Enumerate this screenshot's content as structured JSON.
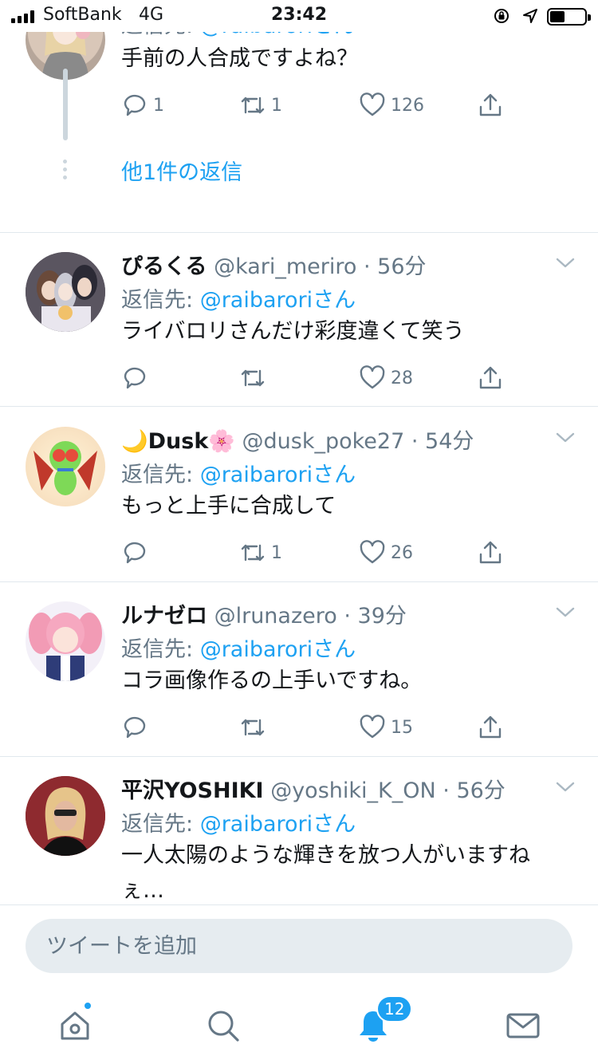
{
  "status_bar": {
    "carrier": "SoftBank",
    "network": "4G",
    "time": "23:42"
  },
  "thread": {
    "reply_to_label": "返信先: ",
    "reply_to_mention": "@raibaroriさん",
    "text": "手前の人合成ですよね？",
    "replies": "1",
    "retweets": "1",
    "likes": "126",
    "more_replies": "他1件の返信"
  },
  "tweets": [
    {
      "name": "ぴるくる",
      "handle": "@kari_meriro",
      "time": "56分",
      "reply_label": "返信先: ",
      "mention": "@raibaroriさん",
      "text": "ライバロリさんだけ彩度違くて笑う",
      "replies": "",
      "retweets": "",
      "likes": "28"
    },
    {
      "name": "🌙Dusk🌸",
      "handle": "@dusk_poke27",
      "time": "54分",
      "reply_label": "返信先: ",
      "mention": "@raibaroriさん",
      "text": "もっと上手に合成して",
      "replies": "",
      "retweets": "1",
      "likes": "26"
    },
    {
      "name": "ルナゼロ",
      "handle": "@lrunazero",
      "time": "39分",
      "reply_label": "返信先: ",
      "mention": "@raibaroriさん",
      "text": "コラ画像作るの上手いですね。",
      "replies": "",
      "retweets": "",
      "likes": "15"
    },
    {
      "name": "平沢YOSHIKI",
      "handle": "@yoshiki_K_ON",
      "time": "56分",
      "reply_label": "返信先: ",
      "mention": "@raibaroriさん",
      "text": "一人太陽のような輝きを放つ人がいますねぇ…",
      "replies": "",
      "retweets": "",
      "likes": ""
    }
  ],
  "compose": {
    "placeholder": "ツイートを追加"
  },
  "tabbar": {
    "notifications_badge": "12"
  },
  "colors": {
    "accent": "#1da1f2",
    "muted": "#657786",
    "divider": "#e1e8ed",
    "compose_bg": "#e6ecf0"
  },
  "icons": [
    "reply-icon",
    "retweet-icon",
    "like-icon",
    "share-icon",
    "chevron-down-icon",
    "home-icon",
    "search-icon",
    "bell-icon",
    "mail-icon"
  ]
}
